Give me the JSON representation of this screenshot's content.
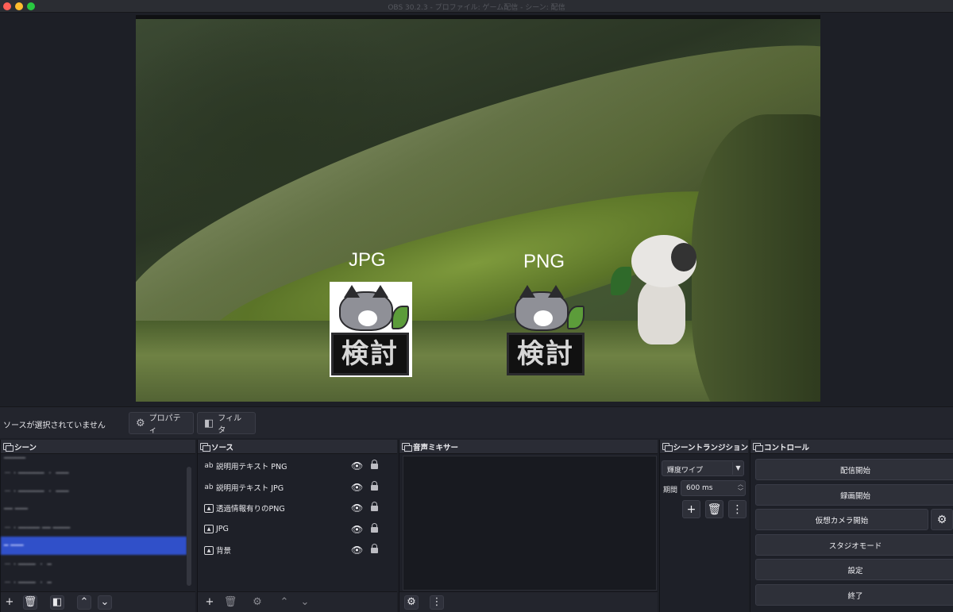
{
  "window": {
    "title": "OBS 30.2.3 - プロファイル: ゲーム配信 - シーン: 配信"
  },
  "preview": {
    "label_jpg": "JPG",
    "label_png": "PNG",
    "sign_text": "検討"
  },
  "status_bar": {
    "no_source_text": "ソースが選択されていません",
    "properties_label": "プロパティ",
    "filters_label": "フィルタ"
  },
  "scenes": {
    "title": "シーン",
    "items": [
      "━━━━━",
      "ー・━━━━━━ ・ ━━━",
      "ー・━━━━━━ ・ ━━━",
      "━━ ━━━",
      "ー・━━━━━ ━━ ━━━━",
      "━ ━━━",
      "ー・━━━━ ・ ━",
      "ー・━━━━ ・ ━"
    ],
    "selected_index": 5
  },
  "sources": {
    "title": "ソース",
    "items": [
      {
        "label": "説明用テキスト PNG",
        "type_icon": "text-source-icon"
      },
      {
        "label": "説明用テキスト JPG",
        "type_icon": "text-source-icon"
      },
      {
        "label": "透過情報有りのPNG",
        "type_icon": "image-source-icon"
      },
      {
        "label": "JPG",
        "type_icon": "image-source-icon"
      },
      {
        "label": "背景",
        "type_icon": "image-source-icon"
      }
    ]
  },
  "mixer": {
    "title": "音声ミキサー"
  },
  "transitions": {
    "title": "シーントランジション",
    "selected": "輝度ワイプ",
    "duration_label": "期間",
    "duration_value": "600 ms"
  },
  "controls": {
    "title": "コントロール",
    "start_streaming": "配信開始",
    "start_recording": "録画開始",
    "start_virtual_camera": "仮想カメラ開始",
    "studio_mode": "スタジオモード",
    "settings": "設定",
    "exit": "終了"
  },
  "colors": {
    "accent_selection": "#3050c9",
    "panel_bg": "#1e2028",
    "header_bg": "#2a2c35"
  }
}
